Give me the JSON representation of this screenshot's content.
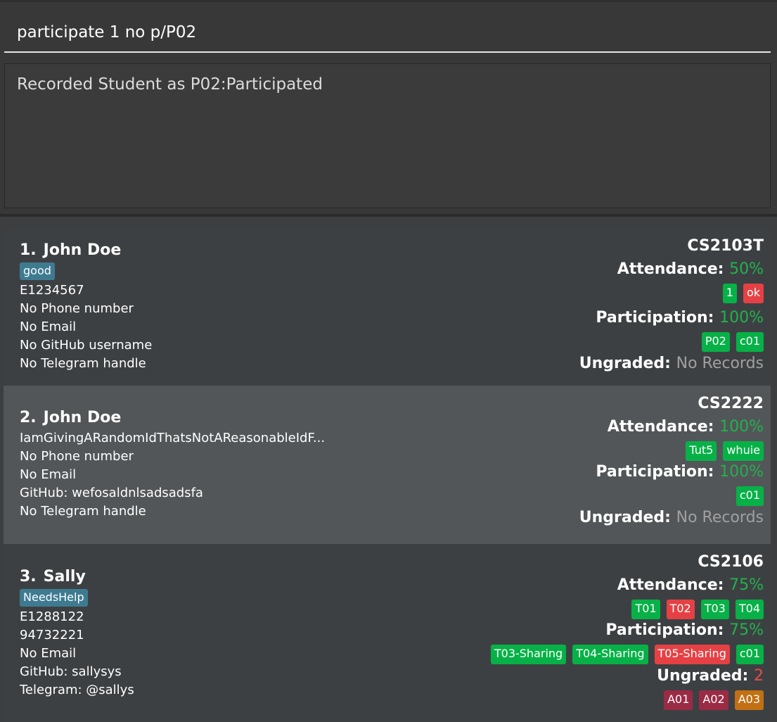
{
  "command_box": {
    "value": "participate 1 no p/P02"
  },
  "result_display": {
    "text": "Recorded Student as P02:Participated"
  },
  "labels": {
    "attendance": "Attendance:",
    "participation": "Participation:",
    "ungraded": "Ungraded:"
  },
  "colors": {
    "present_tag": "#07b147",
    "absent_tag": "#e54144",
    "student_tag": "#3e7b91",
    "percent_text": "#23b14d",
    "ungraded_count": "#e84c4c"
  },
  "students": [
    {
      "index": "1.",
      "name": "John Doe",
      "tag": "good",
      "details": [
        "E1234567",
        "No Phone number",
        "No Email",
        "No GitHub username",
        "No Telegram handle"
      ],
      "module": "CS2103T",
      "attendance_pct": "50%",
      "attendance_tags": [
        {
          "label": "1",
          "status": "present"
        },
        {
          "label": "ok",
          "status": "absent"
        }
      ],
      "participation_pct": "100%",
      "participation_tags": [
        {
          "label": "P02",
          "status": "present"
        },
        {
          "label": "c01",
          "status": "present"
        }
      ],
      "ungraded": "No Records"
    },
    {
      "index": "2.",
      "name": "John Doe",
      "tag": "",
      "details": [
        "IamGivingARandomIdThatsNotAReasonableIdF...",
        "No Phone number",
        "No Email",
        "GitHub: wefosaldnlsadsadsfa",
        "No Telegram handle"
      ],
      "module": "CS2222",
      "attendance_pct": "100%",
      "attendance_tags": [
        {
          "label": "Tut5",
          "status": "present"
        },
        {
          "label": "whuie",
          "status": "present"
        }
      ],
      "participation_pct": "100%",
      "participation_tags": [
        {
          "label": "c01",
          "status": "present"
        }
      ],
      "ungraded": "No Records"
    },
    {
      "index": "3.",
      "name": "Sally",
      "tag": "NeedsHelp",
      "details": [
        "E1288122",
        "94732221",
        "No Email",
        "GitHub: sallysys",
        "Telegram: @sallys"
      ],
      "module": "CS2106",
      "attendance_pct": "75%",
      "attendance_tags": [
        {
          "label": "T01",
          "status": "present"
        },
        {
          "label": "T02",
          "status": "absent"
        },
        {
          "label": "T03",
          "status": "present"
        },
        {
          "label": "T04",
          "status": "present"
        }
      ],
      "participation_pct": "75%",
      "participation_tags": [
        {
          "label": "T03-Sharing",
          "status": "present"
        },
        {
          "label": "T04-Sharing",
          "status": "present"
        },
        {
          "label": "T05-Sharing",
          "status": "absent"
        },
        {
          "label": "c01",
          "status": "present"
        }
      ],
      "ungraded": "2",
      "ungraded_tags": [
        {
          "label": "A01",
          "status": "maroon"
        },
        {
          "label": "A02",
          "status": "maroon"
        },
        {
          "label": "A03",
          "status": "orange"
        }
      ]
    }
  ]
}
